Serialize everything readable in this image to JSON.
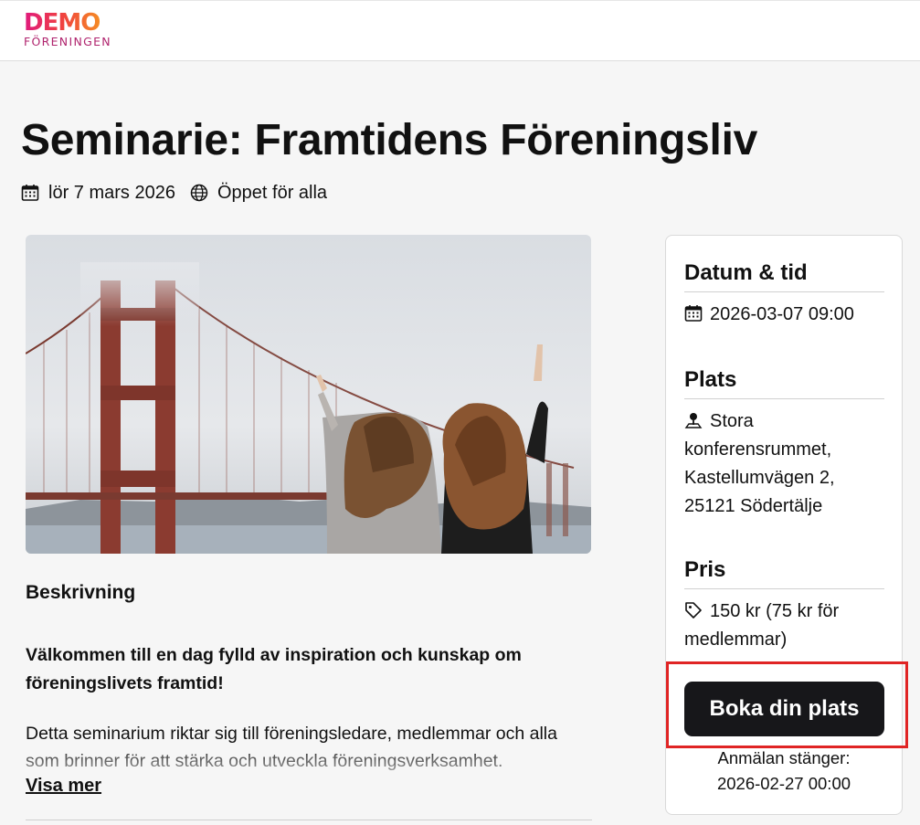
{
  "brand": {
    "logo_main": "DEMO",
    "logo_sub": "FÖRENINGEN"
  },
  "event": {
    "title": "Seminarie: Framtidens Föreningsliv",
    "date_display": "lör 7 mars 2026",
    "visibility": "Öppet för alla"
  },
  "description": {
    "heading": "Beskrivning",
    "lead": "Välkommen till en dag fylld av inspiration och kunskap om föreningslivets framtid!",
    "body": "Detta seminarium riktar sig till föreningsledare, medlemmar och alla som brinner för att stärka och utveckla föreningsverksamhet.",
    "show_more": "Visa mer"
  },
  "sidebar": {
    "datetime_heading": "Datum & tid",
    "datetime_value": "2026-03-07 09:00",
    "location_heading": "Plats",
    "location_value": "Stora konferensrummet, Kastellumvägen 2, 25121 Södertälje",
    "price_heading": "Pris",
    "price_value": "150 kr (75 kr för medlemmar)",
    "book_button": "Boka din plats",
    "closing_label": "Anmälan stänger:",
    "closing_value": "2026-02-27 00:00"
  },
  "colors": {
    "highlight": "#e02424",
    "button": "#17171a",
    "brand_pink": "#e0197d",
    "brand_orange": "#f7a21b"
  },
  "icons": [
    "calendar-icon",
    "globe-icon",
    "location-pin-icon",
    "price-tag-icon"
  ]
}
